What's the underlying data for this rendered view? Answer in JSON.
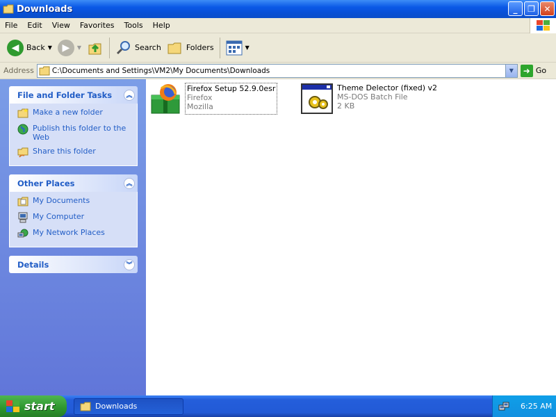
{
  "window": {
    "title": "Downloads"
  },
  "menu": [
    "File",
    "Edit",
    "View",
    "Favorites",
    "Tools",
    "Help"
  ],
  "toolbar": {
    "back": "Back",
    "search": "Search",
    "folders": "Folders"
  },
  "address": {
    "label": "Address",
    "value": "C:\\Documents and Settings\\VM2\\My Documents\\Downloads",
    "go": "Go"
  },
  "tasks": {
    "title": "File and Folder Tasks",
    "items": [
      "Make a new folder",
      "Publish this folder to the Web",
      "Share this folder"
    ]
  },
  "places": {
    "title": "Other Places",
    "items": [
      "My Documents",
      "My Computer",
      "My Network Places"
    ]
  },
  "details": {
    "title": "Details"
  },
  "files": [
    {
      "name": "Firefox Setup 52.9.0esr",
      "line2": "Firefox",
      "line3": "Mozilla",
      "icon": "firefox-installer-icon"
    },
    {
      "name": "Theme Delector (fixed) v2",
      "line2": "MS-DOS Batch File",
      "line3": "2 KB",
      "icon": "batch-file-icon"
    }
  ],
  "taskbar": {
    "start": "start",
    "task": "Downloads",
    "clock": "6:25 AM"
  }
}
